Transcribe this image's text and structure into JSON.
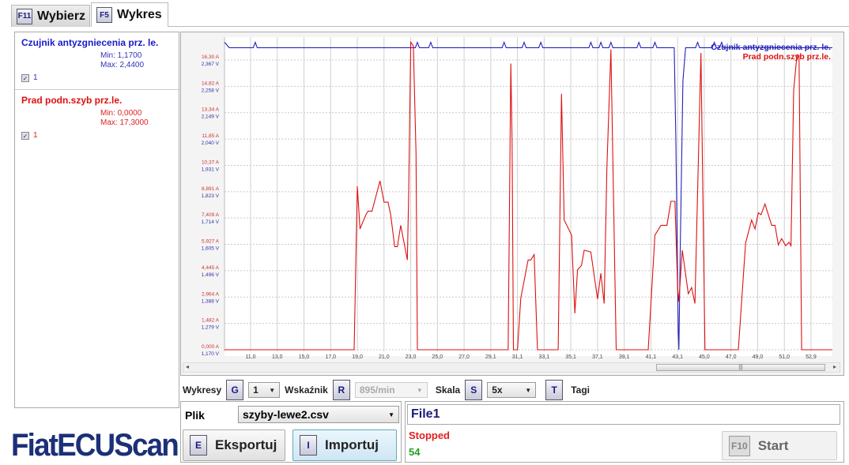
{
  "tabs": [
    {
      "key": "F11",
      "label": "Wybierz",
      "active": false
    },
    {
      "key": "F5",
      "label": "Wykres",
      "active": true
    }
  ],
  "signals": [
    {
      "name": "Czujnik antyzgniecenia prz. le.",
      "min": "Min: 1,1700",
      "max": "Max: 2,4400",
      "check": "1",
      "color": "#1a1acc"
    },
    {
      "name": "Prad podn.szyb prz.le.",
      "min": "Min: 0,0000",
      "max": "Max: 17,3000",
      "check": "1",
      "color": "#dd1111"
    }
  ],
  "toolbar": {
    "wykresy_label": "Wykresy",
    "wykresy_key": "G",
    "wykresy_value": "1",
    "wskaznik_label": "Wskaźnik",
    "wskaznik_key": "R",
    "wskaznik_value": "895/min",
    "skala_label": "Skala",
    "skala_key": "S",
    "skala_value": "5x",
    "tagi_key": "T",
    "tagi_label": "Tagi"
  },
  "file": {
    "label": "Plik",
    "value": "szyby-lewe2.csv",
    "export_key": "E",
    "export_label": "Eksportuj",
    "import_key": "I",
    "import_label": "Importuj"
  },
  "status": {
    "name": "File1",
    "state": "Stopped",
    "count": "54",
    "start_key": "F10",
    "start_label": "Start"
  },
  "logo": "FiatECUScan",
  "chart_data": {
    "type": "line",
    "xlim": [
      9.05,
      54.6
    ],
    "x_ticks": [
      "11,0",
      "13,0",
      "15,0",
      "17,0",
      "19,0",
      "21,0",
      "23,0",
      "25,0",
      "27,0",
      "29,1",
      "31,1",
      "33,1",
      "35,1",
      "37,1",
      "39,1",
      "41,1",
      "43,1",
      "45,0",
      "47,0",
      "49,0",
      "51,0",
      "52,9"
    ],
    "y_ticks_A": [
      "0,000 A",
      "1,482 A",
      "2,964 A",
      "4,445 A",
      "5,927 A",
      "7,409 A",
      "8,891 A",
      "10,37 A",
      "11,85 A",
      "13,34 A",
      "14,82 A",
      "16,30 A"
    ],
    "y_ticks_V": [
      "1,170 V",
      "1,279 V",
      "1,388 V",
      "1,496 V",
      "1,605 V",
      "1,714 V",
      "1,823 V",
      "1,931 V",
      "2,040 V",
      "2,149 V",
      "2,258 V",
      "2,367 V"
    ],
    "ylim_A": [
      0,
      16.3
    ],
    "ylim_V": [
      1.17,
      2.367
    ],
    "grid": true,
    "legend": "top-right",
    "series": [
      {
        "name": "Czujnik antyzgniecenia prz. le.",
        "unit": "V",
        "color": "#2222bb",
        "points": [
          [
            9.05,
            2.44
          ],
          [
            9.4,
            2.418
          ],
          [
            11.2,
            2.418
          ],
          [
            11.35,
            2.44
          ],
          [
            11.5,
            2.418
          ],
          [
            23.35,
            2.418
          ],
          [
            23.5,
            2.44
          ],
          [
            23.65,
            2.418
          ],
          [
            24.35,
            2.418
          ],
          [
            24.5,
            2.44
          ],
          [
            24.65,
            2.418
          ],
          [
            29.85,
            2.418
          ],
          [
            30.0,
            2.44
          ],
          [
            30.15,
            2.418
          ],
          [
            31.35,
            2.418
          ],
          [
            31.5,
            2.44
          ],
          [
            31.65,
            2.418
          ],
          [
            32.6,
            2.418
          ],
          [
            32.75,
            2.44
          ],
          [
            32.9,
            2.418
          ],
          [
            36.35,
            2.418
          ],
          [
            36.5,
            2.44
          ],
          [
            36.65,
            2.418
          ],
          [
            37.1,
            2.418
          ],
          [
            37.25,
            2.44
          ],
          [
            37.4,
            2.418
          ],
          [
            37.85,
            2.418
          ],
          [
            38.0,
            2.44
          ],
          [
            38.15,
            2.418
          ],
          [
            39.95,
            2.418
          ],
          [
            40.1,
            2.44
          ],
          [
            40.25,
            2.418
          ],
          [
            41.15,
            2.418
          ],
          [
            41.3,
            2.44
          ],
          [
            41.45,
            2.418
          ],
          [
            42.75,
            2.418
          ],
          [
            42.87,
            2.03
          ],
          [
            43.05,
            1.245
          ],
          [
            43.1,
            1.17
          ],
          [
            43.2,
            1.58
          ],
          [
            43.4,
            2.28
          ],
          [
            43.6,
            2.418
          ],
          [
            44.35,
            2.418
          ],
          [
            44.5,
            2.44
          ],
          [
            44.65,
            2.418
          ],
          [
            45.6,
            2.418
          ],
          [
            45.75,
            2.44
          ],
          [
            45.9,
            2.418
          ],
          [
            46.15,
            2.418
          ],
          [
            46.3,
            2.44
          ],
          [
            46.45,
            2.418
          ],
          [
            54.6,
            2.418
          ]
        ]
      },
      {
        "name": "Prad podn.szyb prz.le.",
        "unit": "A",
        "color": "#dd1111",
        "points": [
          [
            9.05,
            0
          ],
          [
            18.76,
            0
          ],
          [
            19.0,
            9.2
          ],
          [
            19.2,
            6.8
          ],
          [
            19.65,
            7.6
          ],
          [
            19.8,
            7.8
          ],
          [
            20.1,
            7.8
          ],
          [
            20.7,
            9.5
          ],
          [
            21.0,
            8.3
          ],
          [
            21.3,
            8.3
          ],
          [
            21.5,
            7.6
          ],
          [
            21.8,
            5.8
          ],
          [
            22.0,
            5.8
          ],
          [
            22.25,
            7.0
          ],
          [
            22.75,
            5.05
          ],
          [
            22.85,
            8.8
          ],
          [
            23.0,
            17.3
          ],
          [
            23.2,
            17.1
          ],
          [
            23.4,
            11.0
          ],
          [
            23.5,
            0
          ],
          [
            30.3,
            0
          ],
          [
            30.5,
            16.1
          ],
          [
            30.6,
            11.7
          ],
          [
            30.7,
            0
          ],
          [
            31.0,
            0
          ],
          [
            31.25,
            2.9
          ],
          [
            31.8,
            5.05
          ],
          [
            32.0,
            5.05
          ],
          [
            32.25,
            5.35
          ],
          [
            32.5,
            0
          ],
          [
            34.05,
            0
          ],
          [
            34.3,
            14.4
          ],
          [
            34.5,
            7.3
          ],
          [
            35.05,
            6.45
          ],
          [
            35.3,
            2.05
          ],
          [
            35.5,
            4.5
          ],
          [
            35.8,
            4.75
          ],
          [
            36.0,
            5.6
          ],
          [
            36.5,
            5.5
          ],
          [
            37.0,
            2.85
          ],
          [
            37.25,
            4.3
          ],
          [
            37.5,
            2.6
          ],
          [
            37.7,
            10.2
          ],
          [
            38.0,
            16.9
          ],
          [
            38.4,
            0
          ],
          [
            40.8,
            0
          ],
          [
            41.3,
            6.45
          ],
          [
            41.75,
            7.0
          ],
          [
            42.2,
            7.0
          ],
          [
            42.5,
            8.35
          ],
          [
            42.8,
            8.35
          ],
          [
            43.0,
            3.5
          ],
          [
            43.1,
            2.7
          ],
          [
            43.35,
            5.6
          ],
          [
            43.8,
            3.15
          ],
          [
            44.05,
            3.5
          ],
          [
            44.3,
            2.6
          ],
          [
            44.75,
            16.7
          ],
          [
            45.05,
            0
          ],
          [
            47.55,
            0
          ],
          [
            48.1,
            6.0
          ],
          [
            48.55,
            7.3
          ],
          [
            48.8,
            6.8
          ],
          [
            49.05,
            7.7
          ],
          [
            49.25,
            7.6
          ],
          [
            49.55,
            8.2
          ],
          [
            50.05,
            7.0
          ],
          [
            50.3,
            7.0
          ],
          [
            50.55,
            5.9
          ],
          [
            50.8,
            6.25
          ],
          [
            51.1,
            5.85
          ],
          [
            51.35,
            6.05
          ],
          [
            51.5,
            5.85
          ],
          [
            51.7,
            14.6
          ],
          [
            51.95,
            16.6
          ],
          [
            52.1,
            16.55
          ],
          [
            52.3,
            0
          ],
          [
            54.6,
            0
          ]
        ]
      }
    ]
  }
}
